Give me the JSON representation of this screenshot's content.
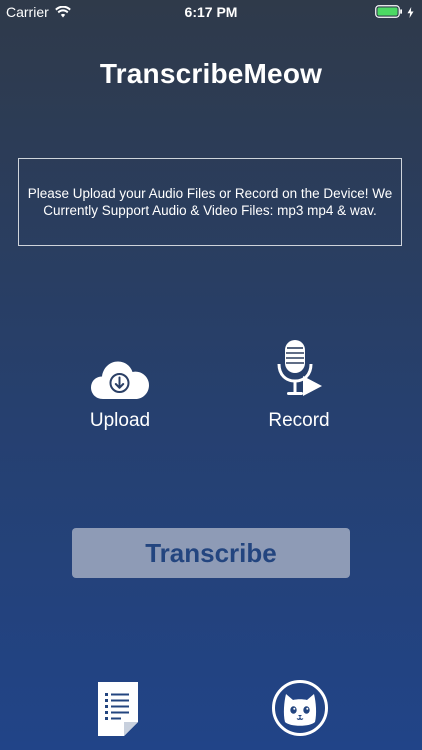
{
  "status_bar": {
    "carrier": "Carrier",
    "time": "6:17 PM",
    "wifi_icon": "wifi-icon",
    "battery_icon": "battery-icon",
    "charging_icon": "bolt-icon",
    "battery_color": "#4cd964"
  },
  "app": {
    "title": "TranscribeMeow"
  },
  "info": {
    "message": "Please Upload your Audio Files or Record on the Device! We Currently Support Audio & Video Files: mp3 mp4 & wav."
  },
  "actions": {
    "upload_label": "Upload",
    "upload_icon": "cloud-download-icon",
    "record_label": "Record",
    "record_icon": "microphone-play-icon"
  },
  "transcribe": {
    "label": "Transcribe",
    "bg_color": "#8e9bb6",
    "text_color": "#23457f"
  },
  "bottom_nav": {
    "documents_icon": "document-list-icon",
    "profile_icon": "cat-face-icon"
  }
}
